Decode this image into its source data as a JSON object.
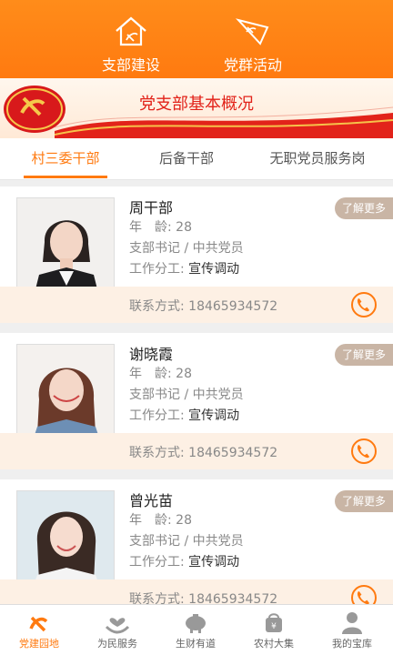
{
  "header": {
    "left_label": "支部建设",
    "right_label": "党群活动"
  },
  "banner": {
    "title": "党支部基本概况"
  },
  "tabs": [
    {
      "label": "村三委干部"
    },
    {
      "label": "后备干部"
    },
    {
      "label": "无职党员服务岗"
    }
  ],
  "cards": [
    {
      "name": "周干部",
      "age_label": "年　龄:",
      "age": "28",
      "role": "支部书记 / 中共党员",
      "duty_label": "工作分工:",
      "duty": "宣传调动",
      "contact_label": "联系方式:",
      "phone": "18465934572",
      "more": "了解更多"
    },
    {
      "name": "谢晓霞",
      "age_label": "年　龄:",
      "age": "28",
      "role": "支部书记 / 中共党员",
      "duty_label": "工作分工:",
      "duty": "宣传调动",
      "contact_label": "联系方式:",
      "phone": "18465934572",
      "more": "了解更多"
    },
    {
      "name": "曾光苗",
      "age_label": "年　龄:",
      "age": "28",
      "role": "支部书记 / 中共党员",
      "duty_label": "工作分工:",
      "duty": "宣传调动",
      "contact_label": "联系方式:",
      "phone": "18465934572",
      "more": "了解更多"
    }
  ],
  "bottom_nav": [
    {
      "label": "党建园地",
      "icon": "party-emblem-icon"
    },
    {
      "label": "为民服务",
      "icon": "heart-hands-icon"
    },
    {
      "label": "生财有道",
      "icon": "piggy-bank-icon"
    },
    {
      "label": "农村大集",
      "icon": "market-basket-icon"
    },
    {
      "label": "我的宝库",
      "icon": "user-icon"
    }
  ],
  "colors": {
    "accent": "#ff7a10",
    "banner_title": "#e2231a",
    "more_button": "#c9b5a5"
  }
}
